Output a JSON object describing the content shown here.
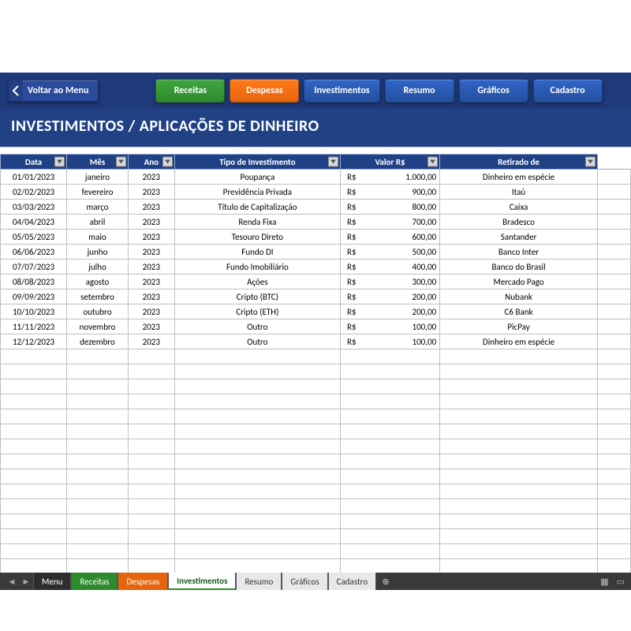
{
  "back_label": "Voltar ao Menu",
  "nav": {
    "receitas": "Receitas",
    "despesas": "Despesas",
    "investimentos": "Investimentos",
    "resumo": "Resumo",
    "graficos": "Gráficos",
    "cadastro": "Cadastro"
  },
  "page_title": "INVESTIMENTOS / APLICAÇÕES DE DINHEIRO",
  "columns": {
    "data": "Data",
    "mes": "Mês",
    "ano": "Ano",
    "tipo": "Tipo de Investimento",
    "valor": "Valor R$",
    "retirado": "Retirado de"
  },
  "currency_prefix": "R$",
  "rows": [
    {
      "data": "01/01/2023",
      "mes": "janeiro",
      "ano": "2023",
      "tipo": "Poupança",
      "valor": "1.000,00",
      "retirado": "Dinheiro em espécie"
    },
    {
      "data": "02/02/2023",
      "mes": "fevereiro",
      "ano": "2023",
      "tipo": "Previdência Privada",
      "valor": "900,00",
      "retirado": "Itaú"
    },
    {
      "data": "03/03/2023",
      "mes": "março",
      "ano": "2023",
      "tipo": "Título de Capitalização",
      "valor": "800,00",
      "retirado": "Caixa"
    },
    {
      "data": "04/04/2023",
      "mes": "abril",
      "ano": "2023",
      "tipo": "Renda Fixa",
      "valor": "700,00",
      "retirado": "Bradesco"
    },
    {
      "data": "05/05/2023",
      "mes": "maio",
      "ano": "2023",
      "tipo": "Tesouro Direto",
      "valor": "600,00",
      "retirado": "Santander"
    },
    {
      "data": "06/06/2023",
      "mes": "junho",
      "ano": "2023",
      "tipo": "Fundo DI",
      "valor": "500,00",
      "retirado": "Banco Inter"
    },
    {
      "data": "07/07/2023",
      "mes": "julho",
      "ano": "2023",
      "tipo": "Fundo Imobiliário",
      "valor": "400,00",
      "retirado": "Banco do Brasil"
    },
    {
      "data": "08/08/2023",
      "mes": "agosto",
      "ano": "2023",
      "tipo": "Ações",
      "valor": "300,00",
      "retirado": "Mercado Pago"
    },
    {
      "data": "09/09/2023",
      "mes": "setembro",
      "ano": "2023",
      "tipo": "Cripto (BTC)",
      "valor": "200,00",
      "retirado": "Nubank"
    },
    {
      "data": "10/10/2023",
      "mes": "outubro",
      "ano": "2023",
      "tipo": "Cripto (ETH)",
      "valor": "200,00",
      "retirado": "C6 Bank"
    },
    {
      "data": "11/11/2023",
      "mes": "novembro",
      "ano": "2023",
      "tipo": "Outro",
      "valor": "100,00",
      "retirado": "PicPay"
    },
    {
      "data": "12/12/2023",
      "mes": "dezembro",
      "ano": "2023",
      "tipo": "Outro",
      "valor": "100,00",
      "retirado": "Dinheiro em espécie"
    }
  ],
  "empty_rows": 16,
  "sheet_tabs": {
    "menu": "Menu",
    "receitas": "Receitas",
    "despesas": "Despesas",
    "investimentos": "Investimentos",
    "resumo": "Resumo",
    "graficos": "Gráficos",
    "cadastro": "Cadastro"
  }
}
